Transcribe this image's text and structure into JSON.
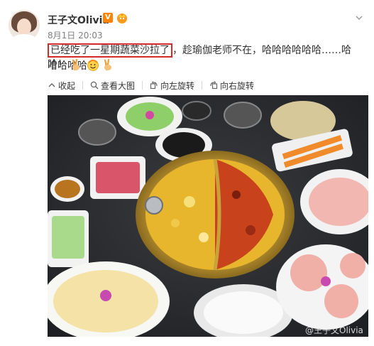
{
  "post": {
    "username": "王子文Olivia",
    "verified_badge": "V",
    "timestamp": "8月1日 20:03",
    "text_highlight": "已经吃了一星期蔬菜沙拉了",
    "text_rest": "，趁瑜伽老师不在，哈哈哈哈哈哈……哈哈哈哈哈",
    "text_line2": "哈！",
    "emojis": [
      "yeah-emoji",
      "happy-emoji",
      "yeah-emoji"
    ]
  },
  "toolbar": {
    "collapse": "收起",
    "view_large": "查看大图",
    "rotate_left": "向左旋转",
    "rotate_right": "向右旋转"
  },
  "image": {
    "watermark": "@王子文Olivia"
  },
  "colors": {
    "highlight_border": "#d62a2a",
    "verified": "#ff8200",
    "meta_text": "#808080"
  }
}
